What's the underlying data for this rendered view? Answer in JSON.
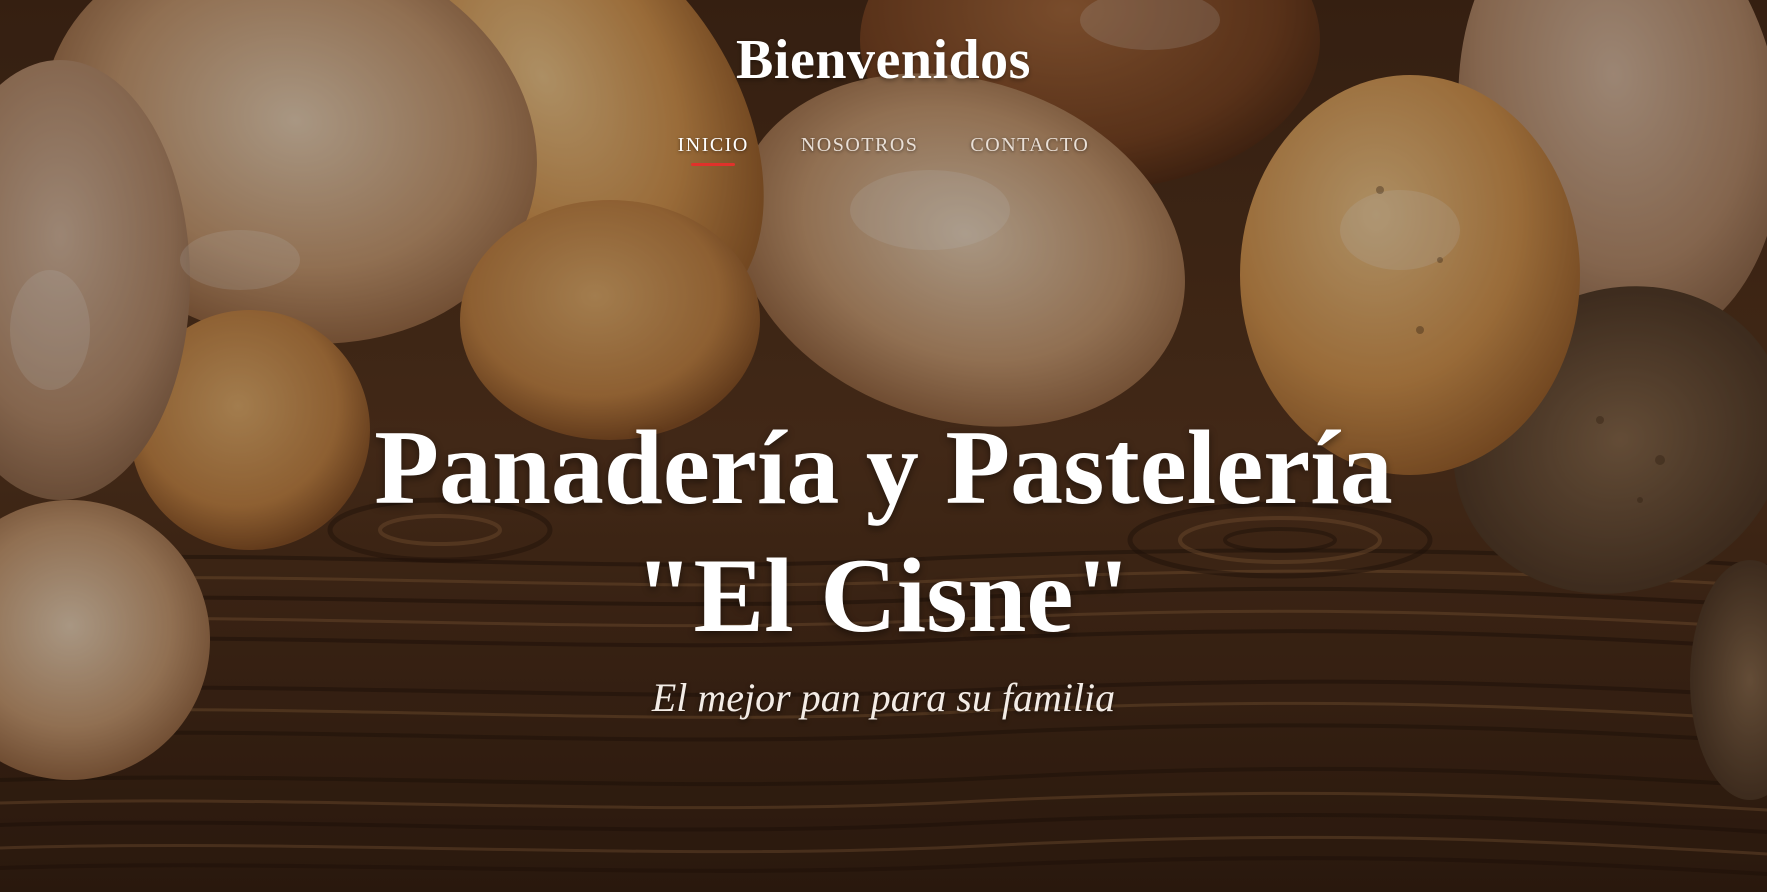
{
  "header": {
    "site_title": "Bienvenidos"
  },
  "nav": {
    "items": [
      {
        "label": "INICIO",
        "active": true
      },
      {
        "label": "NOSOTROS",
        "active": false
      },
      {
        "label": "CONTACTO",
        "active": false
      }
    ],
    "active_indicator_color": "#e0322b"
  },
  "hero": {
    "headline_line1": "Panadería y Pastelería",
    "headline_line2": "\"El Cisne\"",
    "tagline": "El mejor pan para su familia",
    "background_image": "bread-loaves-on-wooden-table"
  },
  "colors": {
    "text": "#ffffff",
    "wood_dark": "#3b2415",
    "bread_crust": "#c98a4a"
  }
}
